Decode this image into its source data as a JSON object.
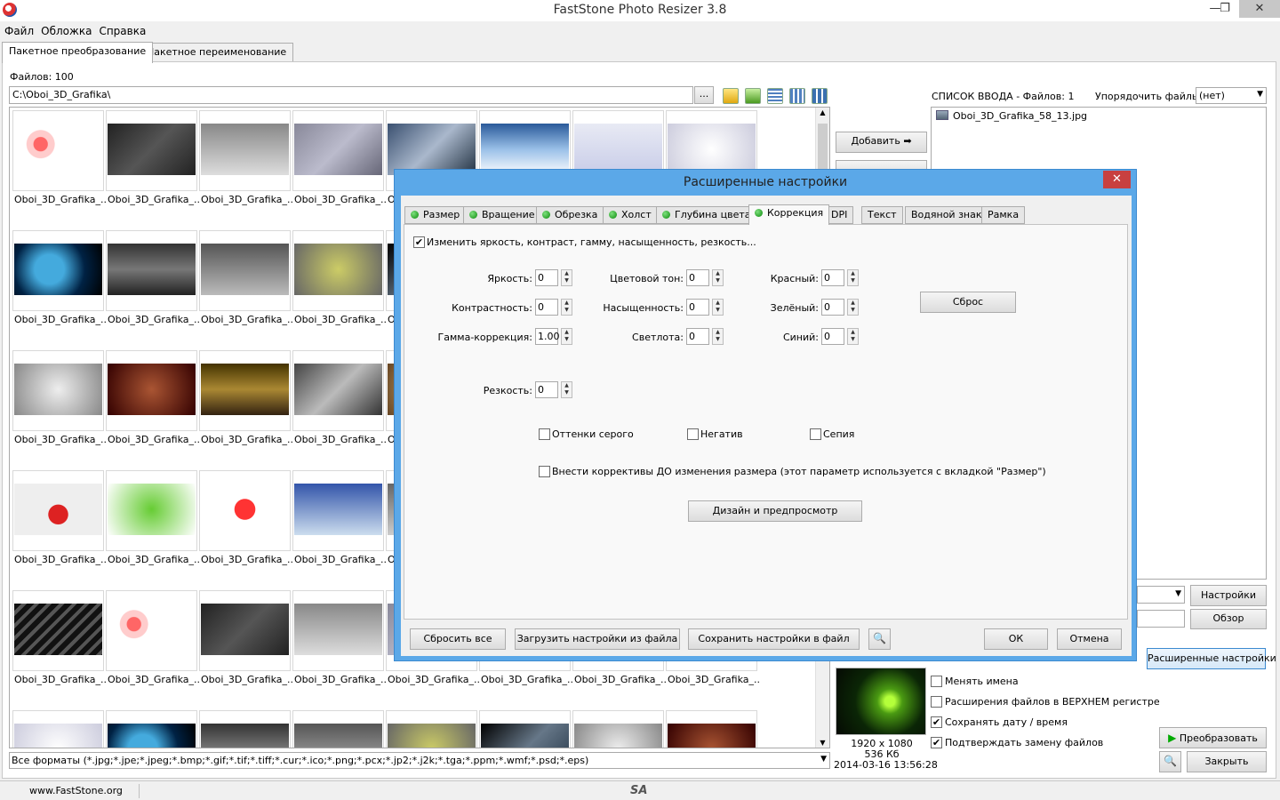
{
  "window": {
    "title": "FastStone Photo Resizer 3.8",
    "minimize": "—",
    "restore": "❐",
    "close": "✕"
  },
  "menu": [
    "Файл",
    "Обложка",
    "Справка"
  ],
  "main_tabs": [
    "Пакетное преобразование",
    "Пакетное переименование"
  ],
  "files_count": "Файлов: 100",
  "folder_path": "C:\\Oboi_3D_Grafika\\",
  "browse_label": "...",
  "thumb_caption": "Oboi_3D_Grafika_...",
  "thumb_caption_cut": "O",
  "format_filter": "Все форматы (*.jpg;*.jpe;*.jpeg;*.bmp;*.gif;*.tif;*.tiff;*.cur;*.ico;*.png;*.pcx;*.jp2;*.j2k;*.tga;*.ppm;*.wmf;*.psd;*.eps)",
  "add_button": "Добавить",
  "input_list": {
    "header": "СПИСОК ВВОДА  -  Файлов: 1",
    "sort_label": "Упорядочить файлы:",
    "sort_value": "(нет)",
    "items": [
      "Oboi_3D_Grafika_58_13.jpg"
    ]
  },
  "right_buttons": {
    "settings": "Настройки",
    "browse": "Обзор",
    "advanced": "Расширенные настройки",
    "convert": "Преобразовать",
    "close": "Закрыть"
  },
  "options": [
    {
      "label": "Менять имена",
      "checked": false
    },
    {
      "label": "Расширения файлов в ВЕРХНЕМ регистре",
      "checked": false
    },
    {
      "label": "Сохранять дату / время",
      "checked": true
    },
    {
      "label": "Подтверждать замену файлов",
      "checked": true
    }
  ],
  "preview_info": {
    "dims": "1920 x 1080",
    "size": "536 Кб",
    "date": "2014-03-16 13:56:28"
  },
  "statusbar": {
    "website": "www.FastStone.org",
    "logo": "SA"
  },
  "dialog": {
    "title": "Расширенные  настройки",
    "tabs": [
      {
        "label": "Размер",
        "dot": true
      },
      {
        "label": "Вращение",
        "dot": true
      },
      {
        "label": "Обрезка",
        "dot": true
      },
      {
        "label": "Холст",
        "dot": true
      },
      {
        "label": "Глубина цвета",
        "dot": true
      },
      {
        "label": "Коррекция",
        "dot": true,
        "active": true
      },
      {
        "label": "DPI",
        "dot": false
      },
      {
        "label": "Текст",
        "dot": false
      },
      {
        "label": "Водяной знак",
        "dot": false
      },
      {
        "label": "Рамка",
        "dot": false
      }
    ],
    "enable_label": "Изменить яркость, контраст, гамму, насыщенность, резкость...",
    "enable_checked": true,
    "fields": {
      "brightness": {
        "label": "Яркость:",
        "value": "0"
      },
      "contrast": {
        "label": "Контрастность:",
        "value": "0"
      },
      "gamma": {
        "label": "Гамма-коррекция:",
        "value": "1.00"
      },
      "hue": {
        "label": "Цветовой тон:",
        "value": "0"
      },
      "saturation": {
        "label": "Насыщенность:",
        "value": "0"
      },
      "lightness": {
        "label": "Светлота:",
        "value": "0"
      },
      "red": {
        "label": "Красный:",
        "value": "0"
      },
      "green": {
        "label": "Зелёный:",
        "value": "0"
      },
      "blue": {
        "label": "Синий:",
        "value": "0"
      },
      "sharpness": {
        "label": "Резкость:",
        "value": "0"
      }
    },
    "reset_label": "Сброс",
    "grayscale": "Оттенки серого",
    "negative": "Негатив",
    "sepia": "Сепия",
    "apply_before": "Внести коррективы ДО изменения размера (этот параметр используется с вкладкой \"Размер\")",
    "design_preview": "Дизайн и предпросмотр",
    "footer": {
      "reset_all": "Сбросить все",
      "load": "Загрузить настройки из файла",
      "save": "Сохранить настройки в файл",
      "ok": "ОК",
      "cancel": "Отмена"
    }
  }
}
